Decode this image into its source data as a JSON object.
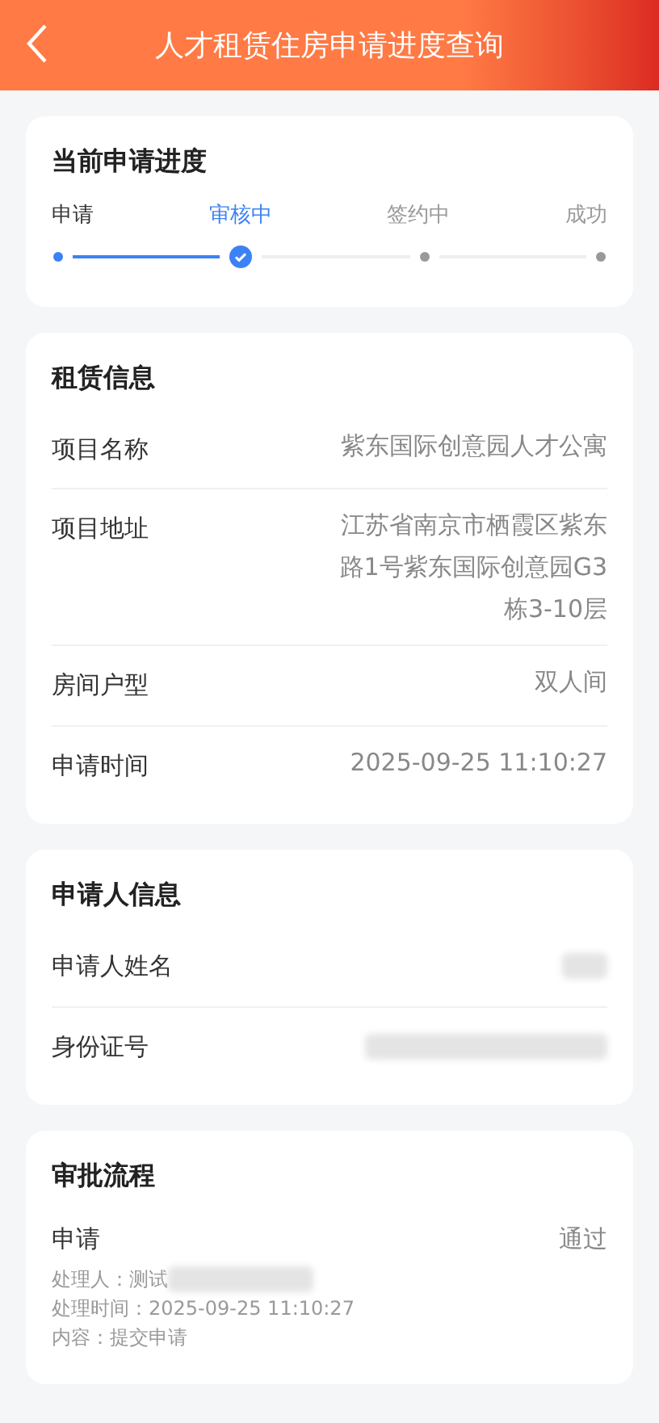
{
  "header": {
    "title": "人才租赁住房申请进度查询"
  },
  "progress": {
    "title": "当前申请进度",
    "steps": [
      {
        "label": "申请",
        "kind": "done"
      },
      {
        "label": "审核中",
        "kind": "current"
      },
      {
        "label": "签约中",
        "kind": "pending"
      },
      {
        "label": "成功",
        "kind": "pending"
      }
    ]
  },
  "rental_info": {
    "title": "租赁信息",
    "rows": [
      {
        "label": "项目名称",
        "value": "紫东国际创意园人才公寓"
      },
      {
        "label": "项目地址",
        "value": "江苏省南京市栖霞区紫东路1号紫东国际创意园G3栋3-10层"
      },
      {
        "label": "房间户型",
        "value": "双人间"
      },
      {
        "label": "申请时间",
        "value": "2025-09-25 11:10:27"
      }
    ]
  },
  "applicant_info": {
    "title": "申请人信息",
    "rows": [
      {
        "label": "申请人姓名",
        "redacted": true
      },
      {
        "label": "身份证号",
        "redacted": true
      }
    ]
  },
  "approval_flow": {
    "title": "审批流程",
    "entries": [
      {
        "step": "申请",
        "result": "通过",
        "handler": "处理人：测试",
        "handler_redacted": true,
        "time": "处理时间：2025-09-25 11:10:27",
        "content": "内容：提交申请"
      }
    ]
  }
}
